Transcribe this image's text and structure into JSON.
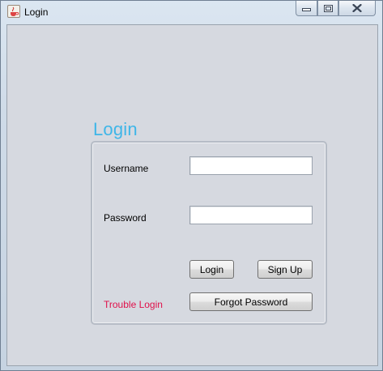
{
  "window": {
    "title": "Login",
    "icon": "java-cup-icon",
    "controls": [
      "minimize-icon",
      "maximize-icon",
      "close-icon"
    ]
  },
  "form": {
    "heading": "Login",
    "username_label": "Username",
    "username_value": "",
    "password_label": "Password",
    "password_value": "",
    "login_button": "Login",
    "signup_button": "Sign Up",
    "trouble_text": "Trouble Login",
    "forgot_button": "Forgot Password"
  },
  "colors": {
    "heading": "#3fb6e8",
    "trouble": "#e0104a",
    "client_bg": "#d6d9e0"
  }
}
